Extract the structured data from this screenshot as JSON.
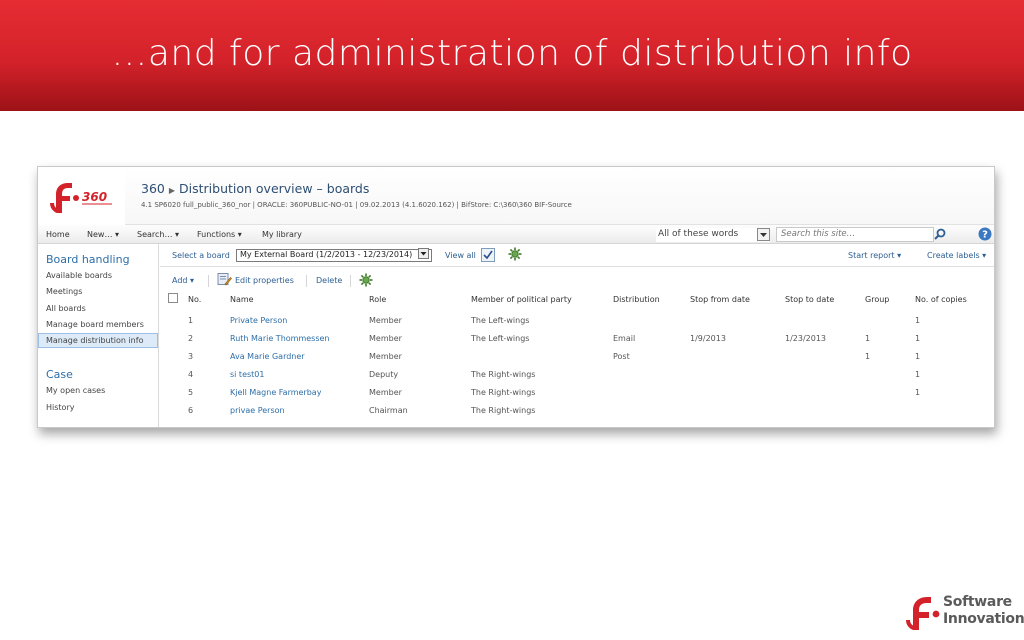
{
  "slide": {
    "title": "…and for administration of distribution info",
    "brand_line1": "Software",
    "brand_line2": "Innovation"
  },
  "app": {
    "logo_text": "360",
    "breadcrumb_root": "360",
    "page_title": "Distribution overview – boards",
    "subtitle": "4.1 SP6020 full_public_360_nor | ORACLE: 360PUBLIC-NO-01 | 09.02.2013 (4.1.6020.162) | BifStore: C:\\360\\360 BIF-Source"
  },
  "menu": {
    "items": [
      "Home",
      "New… ▾",
      "Search… ▾",
      "Functions ▾",
      "My library"
    ],
    "search_scope": "All of these words",
    "search_placeholder": "Search this site…"
  },
  "leftnav": {
    "section1_title": "Board handling",
    "section1_items": [
      "Available boards",
      "Meetings",
      "All boards",
      "Manage board members",
      "Manage distribution info"
    ],
    "section2_title": "Case",
    "section2_items": [
      "My open cases",
      "History"
    ]
  },
  "boardbar": {
    "select_label": "Select a board",
    "selected_board": "My External Board (1/2/2013 - 12/23/2014)",
    "view_all": "View all",
    "start_report": "Start report ▾",
    "create_labels": "Create labels ▾"
  },
  "actions": {
    "add": "Add ▾",
    "edit_properties": "Edit properties",
    "delete": "Delete"
  },
  "table": {
    "headers": [
      "No.",
      "Name",
      "Role",
      "Member of political party",
      "Distribution",
      "Stop from date",
      "Stop to date",
      "Group",
      "No. of copies"
    ],
    "rows": [
      [
        "1",
        "Private Person",
        "Member",
        "The Left-wings",
        "",
        "",
        "",
        "",
        "1"
      ],
      [
        "2",
        "Ruth Marie Thommessen",
        "Member",
        "The Left-wings",
        "Email",
        "1/9/2013",
        "1/23/2013",
        "1",
        "1"
      ],
      [
        "3",
        "Ava Marie Gardner",
        "Member",
        "",
        "Post",
        "",
        "",
        "1",
        "1"
      ],
      [
        "4",
        "si test01",
        "Deputy",
        "The Right-wings",
        "",
        "",
        "",
        "",
        "1"
      ],
      [
        "5",
        "Kjell Magne Farmerbay",
        "Member",
        "The Right-wings",
        "",
        "",
        "",
        "",
        "1"
      ],
      [
        "6",
        "privae Person",
        "Chairman",
        "The Right-wings",
        "",
        "",
        "",
        "",
        ""
      ]
    ]
  },
  "colors": {
    "header_red": "#d4222a",
    "link_blue": "#2d6ea8",
    "selected_nav": "#ddeaf7"
  }
}
